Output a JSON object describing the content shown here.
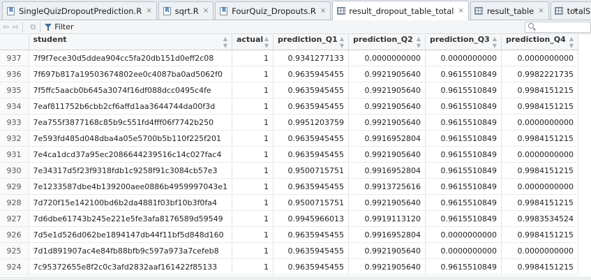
{
  "tabs": [
    {
      "label": "SingleQuizDropoutPrediction.R",
      "icon": "r-file-icon",
      "active": false
    },
    {
      "label": "sqrt.R",
      "icon": "r-file-icon",
      "active": false
    },
    {
      "label": "FourQuiz_Dropouts.R",
      "icon": "r-file-icon",
      "active": false
    },
    {
      "label": "result_dropout_table_total",
      "icon": "table-icon",
      "active": true
    },
    {
      "label": "result_table",
      "icon": "table-icon",
      "active": false
    },
    {
      "label": "totalSet_",
      "icon": "table-icon",
      "active": false
    }
  ],
  "tab_close_glyph": "×",
  "tab_overflow_glyph": "»",
  "toolbar": {
    "filter_label": "Filter"
  },
  "search": {
    "placeholder": ""
  },
  "table": {
    "columns": [
      "",
      "student",
      "actual",
      "prediction_Q1",
      "prediction_Q2",
      "prediction_Q3",
      "prediction_Q4"
    ],
    "rows": [
      [
        "937",
        "7f9f7ece30d5ddea904cc5fa20db151d0eff2c08",
        "1",
        "0.9341277133",
        "0.0000000000",
        "0.0000000000",
        "0.0000000000"
      ],
      [
        "936",
        "7f697b817a19503674802ee0c4087ba0ad5062f0",
        "1",
        "0.9635945455",
        "0.9921905640",
        "0.9615510849",
        "0.9982221735"
      ],
      [
        "935",
        "7f5ffc5aacb0b645a3074f16df088dcc0495c4fe",
        "1",
        "0.9635945455",
        "0.9921905640",
        "0.9615510849",
        "0.9984151215"
      ],
      [
        "934",
        "7eaf811752b6cbb2cf6affd1aa3644744da00f3d",
        "1",
        "0.9635945455",
        "0.9921905640",
        "0.9615510849",
        "0.9984151215"
      ],
      [
        "933",
        "7ea755f3877168c85b9c551fd4fff06f7742b250",
        "1",
        "0.9951203759",
        "0.9921905640",
        "0.9615510849",
        "0.0000000000"
      ],
      [
        "932",
        "7e593fd485d048dba4a05e5700b5b110f225f201",
        "1",
        "0.9635945455",
        "0.9916952804",
        "0.9615510849",
        "0.9984151215"
      ],
      [
        "931",
        "7e4ca1dcd37a95ec2086644239516c14c027fac4",
        "1",
        "0.9635945455",
        "0.9921905640",
        "0.9615510849",
        "0.0000000000"
      ],
      [
        "930",
        "7e34317d5f23f9318fdb1c9258f91c3084cb57e3",
        "1",
        "0.9500715751",
        "0.9916952804",
        "0.9615510849",
        "0.9984151215"
      ],
      [
        "929",
        "7e1233587dbe4b139200aee0886b4959997043e1",
        "1",
        "0.9635945455",
        "0.9913725616",
        "0.9615510849",
        "0.0000000000"
      ],
      [
        "928",
        "7d720f15e142100bd6b2da4881f03bf10b3f0fa4",
        "1",
        "0.9500715751",
        "0.9921905640",
        "0.9615510849",
        "0.9984151215"
      ],
      [
        "927",
        "7d6dbe61743b245e221e5fe3afa8176589d59549",
        "1",
        "0.9945966013",
        "0.9919113120",
        "0.9615510849",
        "0.9983534524"
      ],
      [
        "926",
        "7d5e1d526d062be1894147db44f11bf5d848d160",
        "1",
        "0.9635945455",
        "0.9916952804",
        "0.0000000000",
        "0.9984151215"
      ],
      [
        "925",
        "7d1d891907ac4e84fb88bfb9c597a973a7cefeb8",
        "1",
        "0.9635945455",
        "0.9921905640",
        "0.0000000000",
        "0.0000000000"
      ],
      [
        "924",
        "7c95372655e8f2c0c3afd2832aaf161422f85133",
        "1",
        "0.9635945455",
        "0.9921905640",
        "0.9615510849",
        "0.9984151215"
      ]
    ]
  }
}
